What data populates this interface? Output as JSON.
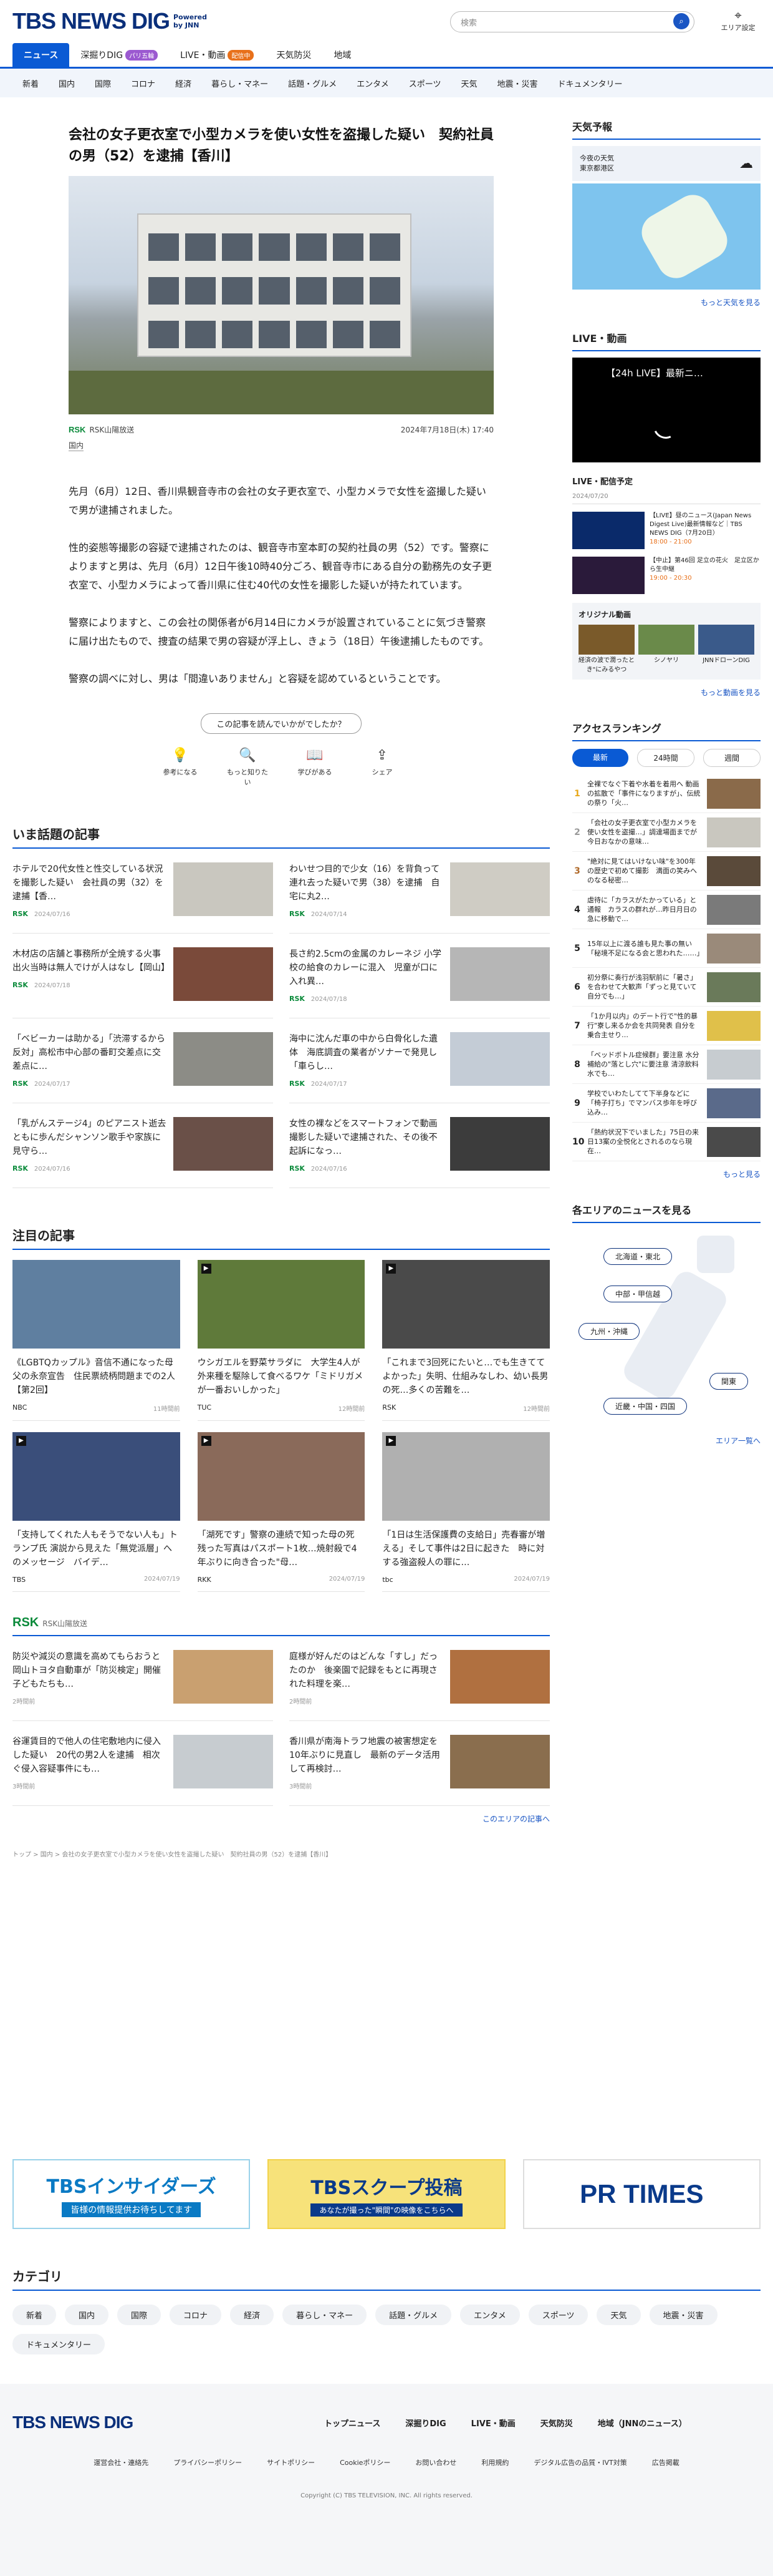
{
  "header": {
    "logo": "TBS NEWS DIG",
    "powered": "Powered",
    "by": "by JNN",
    "search_placeholder": "検索",
    "location": "エリア設定"
  },
  "nav_primary": [
    {
      "label": "ニュース"
    },
    {
      "label": "深掘りDIG",
      "badge": "パリ五輪"
    },
    {
      "label": "LIVE・動画",
      "badge": "配信中"
    },
    {
      "label": "天気防災"
    },
    {
      "label": "地域"
    }
  ],
  "nav_secondary": [
    "新着",
    "国内",
    "国際",
    "コロナ",
    "経済",
    "暮らし・マネー",
    "話題・グルメ",
    "エンタメ",
    "スポーツ",
    "天気",
    "地震・災害",
    "ドキュメンタリー"
  ],
  "article": {
    "title": "会社の女子更衣室で小型カメラを使い女性を盗撮した疑い　契約社員の男（52）を逮捕【香川】",
    "source": "RSK山陽放送",
    "source_logo": "RSK",
    "date": "2024年7月18日(木) 17:40",
    "tag": "国内",
    "paragraphs": [
      "先月（6月）12日、香川県観音寺市の会社の女子更衣室で、小型カメラで女性を盗撮した疑いで男が逮捕されました。",
      "性的姿態等撮影の容疑で逮捕されたのは、観音寺市室本町の契約社員の男（52）です。警察によりますと男は、先月（6月）12日午後10時40分ごろ、観音寺市にある自分の勤務先の女子更衣室で、小型カメラによって香川県に住む40代の女性を撮影した疑いが持たれています。",
      "警察によりますと、この会社の関係者が6月14日にカメラが設置されていることに気づき警察に届け出たもので、捜査の結果で男の容疑が浮上し、きょう（18日）午後逮捕したものです。",
      "警察の調べに対し、男は「間違いありません」と容疑を認めているということです。"
    ]
  },
  "feedback": {
    "question": "この記事を読んでいかがでしたか？",
    "buttons": [
      "参考になる",
      "もっと知りたい",
      "学びがある",
      "シェア"
    ]
  },
  "trending": {
    "heading": "いま話題の記事",
    "items": [
      {
        "title": "ホテルで20代女性と性交している状況を撮影した疑い　会社員の男（32）を逮捕【香…",
        "src": "RSK",
        "date": "2024/07/16"
      },
      {
        "title": "わいせつ目的で少女（16）を背負って連れ去った疑いで男（38）を逮捕　自宅に丸2…",
        "src": "RSK",
        "date": "2024/07/14"
      },
      {
        "title": "木材店の店舗と事務所が全焼する火事　出火当時は無人でけが人はなし【岡山】",
        "src": "RSK",
        "date": "2024/07/18"
      },
      {
        "title": "長さ約2.5cmの金属のカレーネジ 小学校の給食のカレーに混入　児童が口に入れ異…",
        "src": "RSK",
        "date": "2024/07/18"
      },
      {
        "title": "「ベビーカーは助かる」「渋滞するから反対」高松市中心部の番町交差点に交差点に…",
        "src": "RSK",
        "date": "2024/07/17"
      },
      {
        "title": "海中に沈んだ車の中から白骨化した遺体　海底調査の業者がソナーで発見し「車らし…",
        "src": "RSK",
        "date": "2024/07/17"
      },
      {
        "title": "「乳がんステージ4」のピアニスト逝去　ともに歩んだシャンソン歌手や家族に見守ら…",
        "src": "RSK",
        "date": "2024/07/16"
      },
      {
        "title": "女性の裸などをスマートフォンで動画撮影した疑いで逮捕された、その後不起訴になっ…",
        "src": "RSK",
        "date": "2024/07/16"
      }
    ]
  },
  "featured": {
    "heading": "注目の記事",
    "items": [
      {
        "title": "《LGBTQカップル》音信不通になった母　父の永奈宣告　住民票続柄問題までの2人【第2回】",
        "src": "NBC",
        "date": "11時間前"
      },
      {
        "title": "ウシガエルを野菜サラダに　大学生4人が外来種を駆除して食べるワケ「ミドリガメが一番おいしかった」",
        "src": "TUC",
        "date": "12時間前"
      },
      {
        "title": "「これまで3回死にたいと…でも生きててよかった」失明、仕組みなしわ、幼い長男の死…多くの苦難を…",
        "src": "RSK",
        "date": "12時間前"
      },
      {
        "title": "「支持してくれた人もそうでない人も」トランプ氏 演説から見えた「無党派層」へのメッセージ　バイデ…",
        "src": "TBS",
        "date": "2024/07/19"
      },
      {
        "title": "「湖死です」警察の連続で知った母の死 残った写真はパスポート1枚…焼射殺で4年ぶりに向き合った\"母…",
        "src": "RKK",
        "date": "2024/07/19"
      },
      {
        "title": "「1日は生活保護費の支給日」売春審が増える」そして事件は2日に起きた　時に対する強盗殺人の罪に…",
        "src": "tbc",
        "date": "2024/07/19"
      }
    ]
  },
  "local": {
    "logo": "RSK",
    "name": "RSK山陽放送",
    "items": [
      {
        "title": "防災や減災の意識を高めてもらおうと岡山トヨタ自動車が「防災検定」開催　子どもたちも…",
        "date": "2時間前"
      },
      {
        "title": "庭様が好んだのはどんな「すし」だったのか　後楽園で記録をもとに再現された料理を楽…",
        "date": "2時間前"
      },
      {
        "title": "谷運賃目的で他人の住宅敷地内に侵入した疑い　20代の男2人を逮捕　相次ぐ侵入容疑事件にも…",
        "date": "3時間前"
      },
      {
        "title": "香川県が南海トラフ地震の被害想定を10年ぶりに見直し　最新のデータ活用して再検討…",
        "date": "3時間前"
      }
    ],
    "more": "このエリアの記事へ"
  },
  "breadcrumb": "トップ > 国内 > 会社の女子更衣室で小型カメラを使い女性を盗撮した疑い　契約社員の男（52）を逮捕【香川】",
  "banners": [
    {
      "title": "TBSインサイダーズ",
      "sub": "皆様の情報提供お待ちしてます"
    },
    {
      "title": "TBSスクープ投稿",
      "sub": "あなたが撮った\"瞬間\"の映像をこちらへ"
    },
    {
      "title": "PR TIMES",
      "sub": ""
    }
  ],
  "categories": {
    "heading": "カテゴリ",
    "items": [
      "新着",
      "国内",
      "国際",
      "コロナ",
      "経済",
      "暮らし・マネー",
      "話題・グルメ",
      "エンタメ",
      "スポーツ",
      "天気",
      "地震・災害",
      "ドキュメンタリー"
    ]
  },
  "sidebar": {
    "weather": {
      "heading": "天気予報",
      "today": "今夜の天気",
      "area": "東京都港区",
      "more": "もっと天気を見る"
    },
    "live": {
      "heading": "LIVE・動画",
      "title": "【24h LIVE】最新ニ…",
      "schedule_heading": "LIVE・配信予定",
      "schedule_date": "2024/07/20",
      "items": [
        {
          "title": "【LIVE】昼のニュース(Japan News Digest Live)最新情報など｜TBS NEWS DIG（7月20日）",
          "time": "18:00 - 21:00"
        },
        {
          "title": "【中止】第46回 足立の花火　足立区から生中継",
          "time": "19:00 - 20:30"
        }
      ],
      "original_heading": "オリジナル動画",
      "originals": [
        "経済の波で潤ったとき\"にみるやつ",
        "シノヤリ",
        "JNNドローンDIG"
      ],
      "more": "もっと動画を見る"
    },
    "ranking": {
      "heading": "アクセスランキング",
      "tabs": [
        "最新",
        "24時間",
        "週間"
      ],
      "items": [
        "全裸でなぐ下着や水着を着用へ 動画の拡散で「事件になりますが」、伝統の祭り「火…",
        "「会社の女子更衣室で小型カメラを使い女性を盗撮…」調達場面までが今日おなかの意味…",
        "\"絶対に見てはいけない味\"を300年の歴史で初めて撮影　満面の笑みへのなる秘密…",
        "虐待に「カラスがたかっている」と通報　カラスの群れが…昨日月日の急に移動で…",
        "15年以上に渡る誰も見た事の無い「秘境不足になる会と思われた……」",
        "初分祭に奏行が浅羽駅前に「暑さ」を合わせて大歓声「ずっと見ていて自分でも…」",
        "「1か月以内」のデート行で\"性的暴行\"寮し来るか会を共同発表 自分を乗合主せり…",
        "「ベッドボトル症候群」要注意 水分補給の\"落とし穴\"に要注意 清涼飲料水でも…",
        "学校でいわたしてて下半身などに「椅子打ち」でマンバス歩年を呼び込み…",
        "「熱約状況下でいました」75日の来日13案の全悦化とされるのなら現在…"
      ],
      "more": "もっと見る"
    },
    "area": {
      "heading": "各エリアのニュースを見る",
      "regions": [
        "北海道・東北",
        "中部・甲信越",
        "九州・沖縄",
        "関東",
        "近畿・中国・四国"
      ],
      "more": "エリア一覧へ"
    }
  },
  "footer": {
    "logo": "TBS NEWS DIG",
    "nav": [
      "トップニュース",
      "深掘りDIG",
      "LIVE・動画",
      "天気防災",
      "地域（JNNのニュース）"
    ],
    "links": [
      "運営会社・連絡先",
      "プライバシーポリシー",
      "サイトポリシー",
      "Cookieポリシー",
      "お問い合わせ",
      "利用規約",
      "デジタル広告の品質・IVT対策",
      "広告掲載"
    ],
    "copyright": "Copyright (C) TBS TELEVISION, INC. All rights reserved."
  }
}
